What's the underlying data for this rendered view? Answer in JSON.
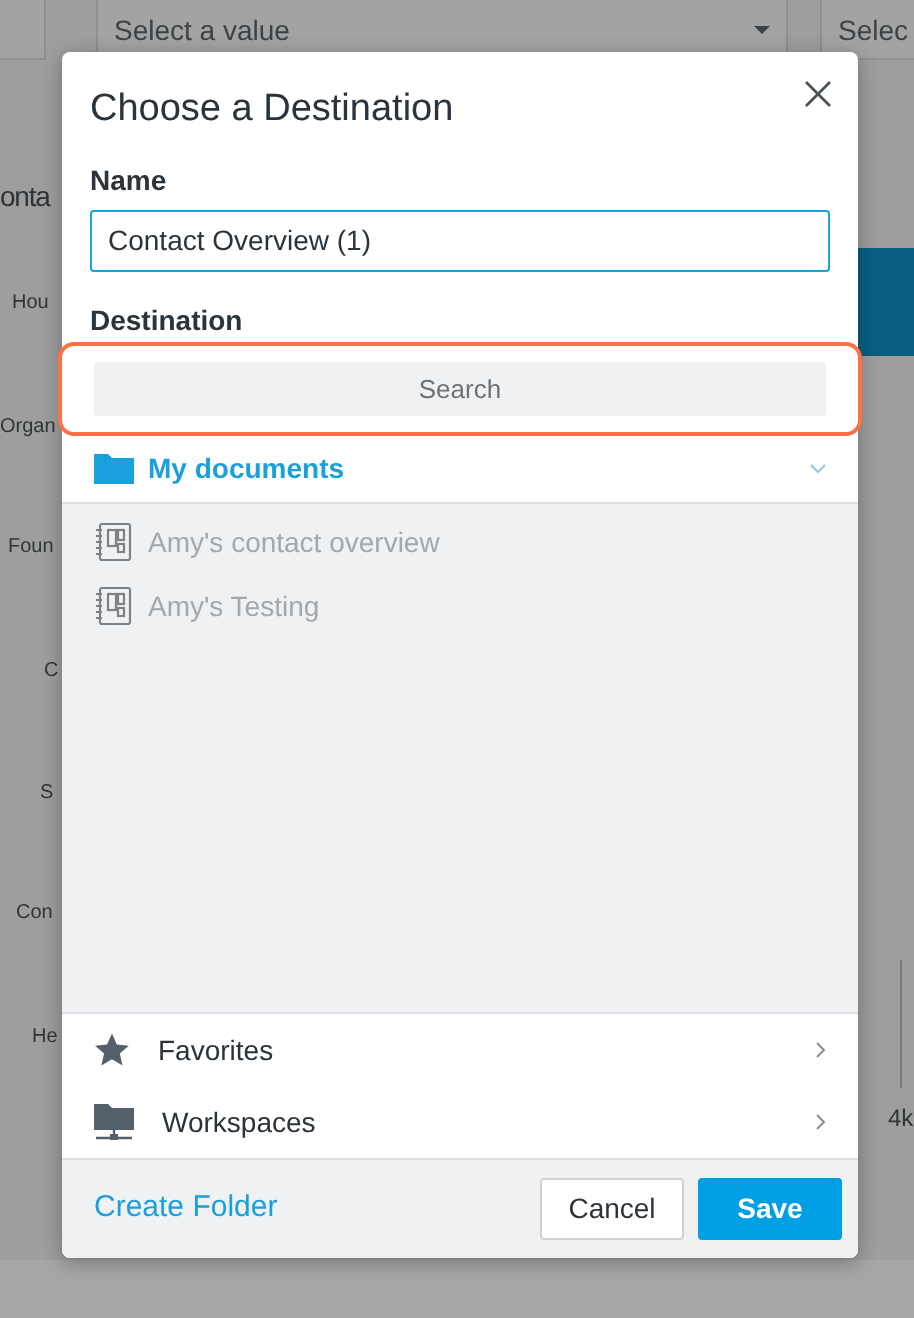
{
  "background": {
    "selects": [
      {
        "text": "Select a value"
      },
      {
        "text": "Selec"
      }
    ],
    "heading": "onta",
    "labels": [
      "Hou",
      "Organ",
      "Foun",
      "C",
      "S",
      "Con",
      "He"
    ],
    "axis_label": "4k"
  },
  "dialog": {
    "title": "Choose a Destination",
    "name_label": "Name",
    "name_value": "Contact Overview (1)",
    "destination_label": "Destination",
    "search": {
      "placeholder": "Search",
      "highlighted": true
    },
    "root": {
      "label": "My documents",
      "expanded": true,
      "children": [
        {
          "label": "Amy's contact overview",
          "disabled": true
        },
        {
          "label": "Amy's Testing",
          "disabled": true
        }
      ]
    },
    "sections": [
      {
        "label": "Favorites",
        "kind": "favorites"
      },
      {
        "label": "Workspaces",
        "kind": "workspaces"
      }
    ],
    "create_folder": "Create Folder",
    "buttons": [
      {
        "label": "Cancel",
        "kind": "secondary"
      },
      {
        "label": "Save",
        "kind": "primary"
      }
    ]
  }
}
